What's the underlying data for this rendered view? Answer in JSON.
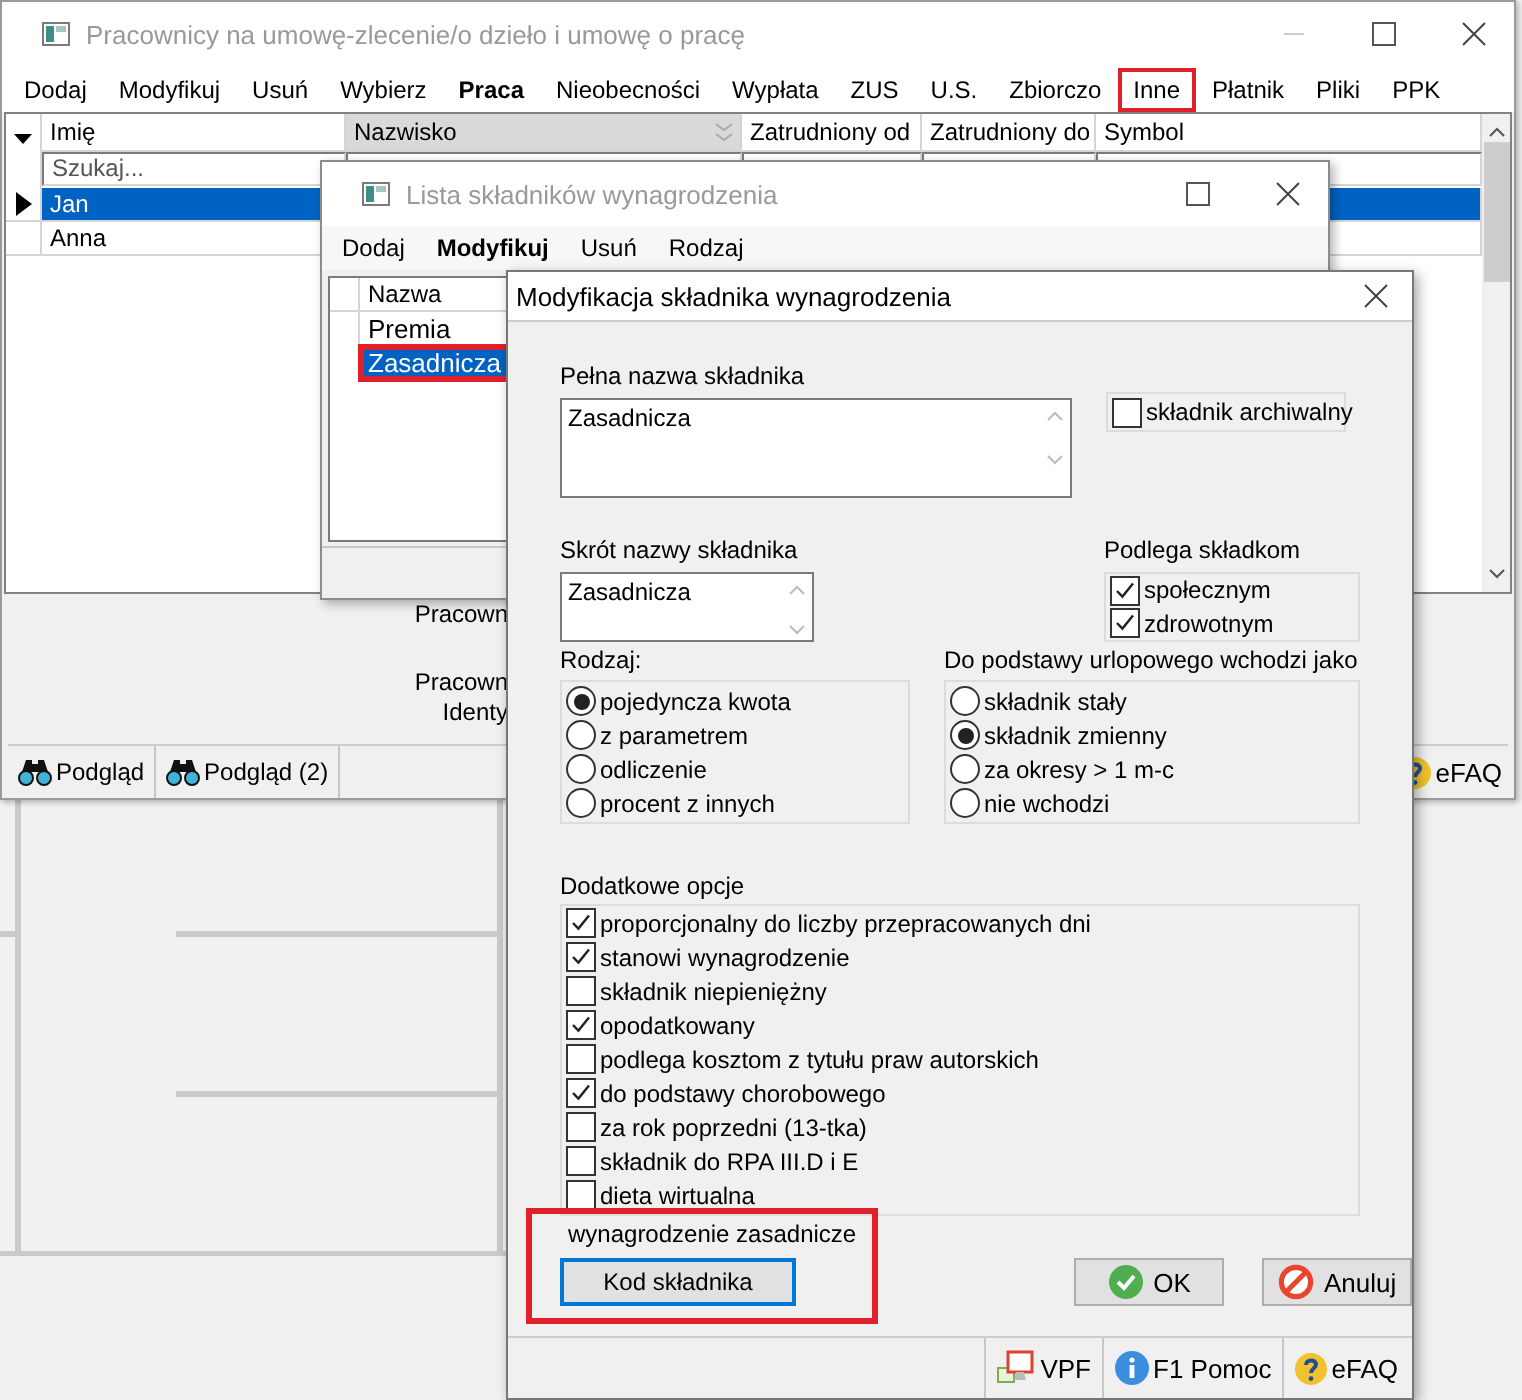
{
  "main_window": {
    "title": "Pracownicy na umowę-zlecenie/o dzieło i umowę o pracę",
    "menu": [
      {
        "label": "Dodaj",
        "bold": false,
        "highlighted": false
      },
      {
        "label": "Modyfikuj",
        "bold": false,
        "highlighted": false
      },
      {
        "label": "Usuń",
        "bold": false,
        "highlighted": false
      },
      {
        "label": "Wybierz",
        "bold": false,
        "highlighted": false
      },
      {
        "label": "Praca",
        "bold": true,
        "highlighted": false
      },
      {
        "label": "Nieobecności",
        "bold": false,
        "highlighted": false
      },
      {
        "label": "Wypłata",
        "bold": false,
        "highlighted": false
      },
      {
        "label": "ZUS",
        "bold": false,
        "highlighted": false
      },
      {
        "label": "U.S.",
        "bold": false,
        "highlighted": false
      },
      {
        "label": "Zbiorczo",
        "bold": false,
        "highlighted": false
      },
      {
        "label": "Inne",
        "bold": false,
        "highlighted": true
      },
      {
        "label": "Płatnik",
        "bold": false,
        "highlighted": false
      },
      {
        "label": "Pliki",
        "bold": false,
        "highlighted": false
      },
      {
        "label": "PPK",
        "bold": false,
        "highlighted": false
      }
    ],
    "table": {
      "columns": [
        {
          "label": "Imię",
          "sorted": false
        },
        {
          "label": "Nazwisko",
          "sorted": true
        },
        {
          "label": "Zatrudniony od",
          "sorted": false
        },
        {
          "label": "Zatrudniony do",
          "sorted": false
        },
        {
          "label": "Symbol",
          "sorted": false
        }
      ],
      "search_placeholder": "Szukaj...",
      "rows": [
        {
          "name": "Jan",
          "selected": true
        },
        {
          "name": "Anna",
          "selected": false
        }
      ]
    },
    "details_labels": [
      "Pracown",
      "Pracown",
      "Identy"
    ],
    "toolbar": [
      "Podgląd",
      "Podgląd (2)"
    ],
    "help_button": "eFAQ"
  },
  "list_window": {
    "title": "Lista składników wynagrodzenia",
    "menu": [
      {
        "label": "Dodaj",
        "bold": false
      },
      {
        "label": "Modyfikuj",
        "bold": true
      },
      {
        "label": "Usuń",
        "bold": false
      },
      {
        "label": "Rodzaj",
        "bold": false
      }
    ],
    "column": "Nazwa",
    "rows": [
      {
        "name": "Premia",
        "selected": false,
        "highlighted": false
      },
      {
        "name": "Zasadnicza",
        "selected": true,
        "highlighted": true
      }
    ]
  },
  "dialog": {
    "title": "Modyfikacja składnika wynagrodzenia",
    "full_name": {
      "label": "Pełna nazwa składnika",
      "value": "Zasadnicza"
    },
    "archive": {
      "label": "składnik archiwalny",
      "checked": false
    },
    "short_name": {
      "label": "Skrót nazwy składnika",
      "value": "Zasadnicza"
    },
    "contributions": {
      "label": "Podlega składkom",
      "options": [
        {
          "label": "społecznym",
          "checked": true
        },
        {
          "label": "zdrowotnym",
          "checked": true
        }
      ]
    },
    "category_group": {
      "label": "Rodzaj:",
      "options": [
        {
          "label": "pojedyncza kwota",
          "selected": true
        },
        {
          "label": "z parametrem",
          "selected": false
        },
        {
          "label": "odliczenie",
          "selected": false
        },
        {
          "label": "procent z innych",
          "selected": false
        }
      ]
    },
    "vacation_group": {
      "label": "Do podstawy urlopowego wchodzi jako",
      "options": [
        {
          "label": "składnik stały",
          "selected": false
        },
        {
          "label": "składnik zmienny",
          "selected": true
        },
        {
          "label": "za okresy > 1 m-c",
          "selected": false
        },
        {
          "label": "nie wchodzi",
          "selected": false
        }
      ]
    },
    "extra_options": {
      "label": "Dodatkowe opcje",
      "options": [
        {
          "label": "proporcjonalny do liczby przepracowanych dni",
          "checked": true
        },
        {
          "label": "stanowi wynagrodzenie",
          "checked": true
        },
        {
          "label": "składnik niepieniężny",
          "checked": false
        },
        {
          "label": "opodatkowany",
          "checked": true
        },
        {
          "label": "podlega kosztom z tytułu praw autorskich",
          "checked": false
        },
        {
          "label": "do podstawy chorobowego",
          "checked": true
        },
        {
          "label": "za rok poprzedni (13-tka)",
          "checked": false
        },
        {
          "label": "składnik do RPA III.D i E",
          "checked": false
        },
        {
          "label": "dieta wirtualna",
          "checked": false
        }
      ]
    },
    "code_caption": "wynagrodzenie zasadnicze",
    "code_button": {
      "label": "Kod składnika",
      "focused": true
    },
    "code_highlighted": true,
    "buttons": [
      {
        "label": "OK",
        "kind": "ok"
      },
      {
        "label": "Anuluj",
        "kind": "cancel"
      }
    ],
    "footer_buttons": [
      {
        "label": "VPF",
        "kind": "vpf"
      },
      {
        "label": "F1 Pomoc",
        "kind": "info"
      },
      {
        "label": "eFAQ",
        "kind": "faq"
      }
    ]
  }
}
